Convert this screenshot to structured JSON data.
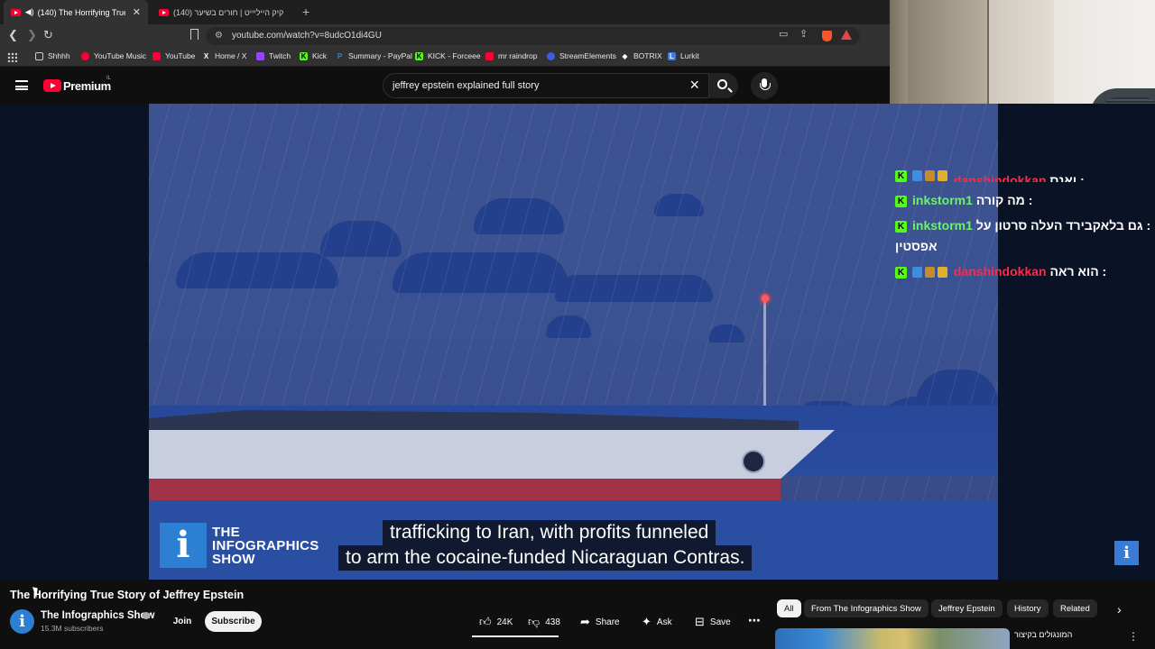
{
  "browser": {
    "tabs": [
      {
        "title": "(140) The Horrifying True Stor"
      },
      {
        "title": "קיק הייליייט | חורים בשיער (140)"
      }
    ],
    "url": "youtube.com/watch?v=8udcO1di4GU",
    "bookmarks": [
      "Shhhh",
      "YouTube Music",
      "YouTube",
      "Home / X",
      "Twitch",
      "Kick",
      "Summary - PayPal",
      "KICK - Forceee",
      "mr raindrop",
      "StreamElements",
      "BOTRIX",
      "Lurkit"
    ]
  },
  "youtube": {
    "brand": "Premium",
    "country": "IL",
    "search_query": "jeffrey epstein explained full story"
  },
  "video": {
    "captions": [
      "trafficking to Iran, with profits funneled",
      "to arm the cocaine-funded Nicaraguan Contras."
    ],
    "watermark_lines": [
      "THE",
      "INFOGRAPHICS",
      "SHOW"
    ],
    "watermark_letter": "i",
    "title": "The Horrifying True Story of Jeffrey Epstein"
  },
  "chat": {
    "messages": [
      {
        "user": "danshindokkan",
        "text": "ואנס :",
        "color": "#ff2a45"
      },
      {
        "user": "inkstorm1",
        "text": "מה קורה :",
        "color": "#6ef26e"
      },
      {
        "user": "inkstorm1",
        "text": "גם בלאקבירד העלה סרטון על :",
        "text2": "אפסטין",
        "color": "#6ef26e"
      },
      {
        "user": "danshindokkan",
        "text": "הוא ראה :",
        "color": "#ff2a45"
      }
    ]
  },
  "channel": {
    "name": "The Infographics Show",
    "subscribers": "15.3M subscribers",
    "join_label": "Join",
    "subscribe_label": "Subscribe"
  },
  "actions": {
    "likes": "24K",
    "dislikes": "438",
    "share": "Share",
    "ask": "Ask",
    "save": "Save"
  },
  "chips": [
    "All",
    "From The Infographics Show",
    "Jeffrey Epstein",
    "History",
    "Related"
  ],
  "recommendation": {
    "title": "המונגולים בקיצור"
  }
}
